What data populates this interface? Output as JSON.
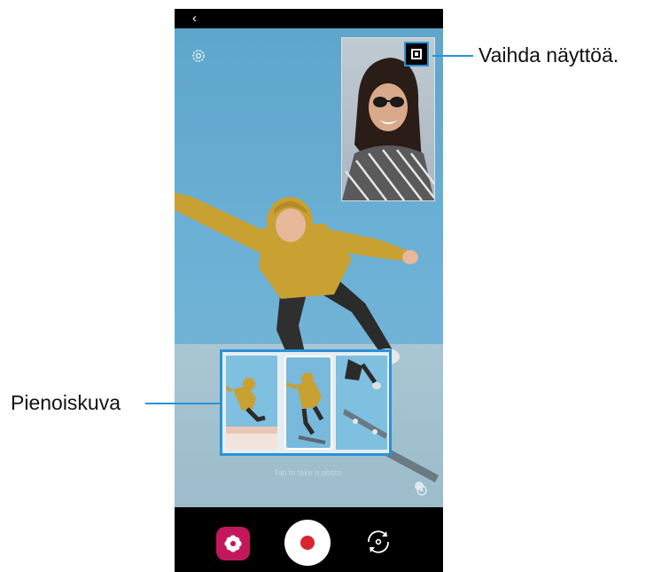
{
  "screen": {
    "back_icon": "back-arrow-icon",
    "hint_text": "Tap to take a photo",
    "effects_icon": "flower-icon",
    "record_icon": "record-dot-icon",
    "switch_camera_icon": "rotate-camera-icon",
    "settings_icon": "gear-icon"
  },
  "annotations": {
    "switch_screen_label": "Vaihda näyttöä.",
    "thumbnail_label": "Pienoiskuva"
  },
  "colors": {
    "accent": "#2a92d9",
    "record_red": "#d8262f",
    "effects_pink": "#c2185b"
  }
}
